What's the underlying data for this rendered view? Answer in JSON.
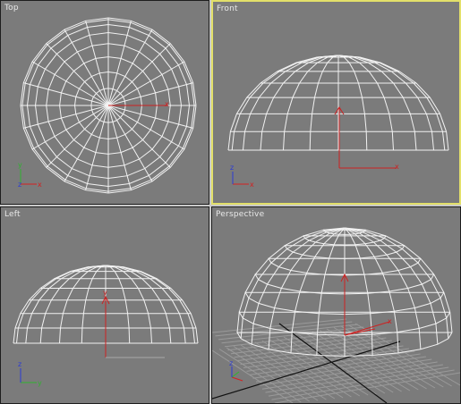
{
  "viewports": {
    "top": {
      "label": "Top"
    },
    "front": {
      "label": "Front"
    },
    "left": {
      "label": "Left"
    },
    "perspective": {
      "label": "Perspective"
    }
  },
  "axes": {
    "x": "x",
    "y": "y",
    "z": "z"
  },
  "colors": {
    "background": "#7b7b7b",
    "wire": "#f2f2f2",
    "active_border": "#e3e06a",
    "axis_x": "#d42020",
    "axis_y": "#2fb32f",
    "axis_z": "#2b3bd6",
    "pivot": "#cc2222"
  }
}
